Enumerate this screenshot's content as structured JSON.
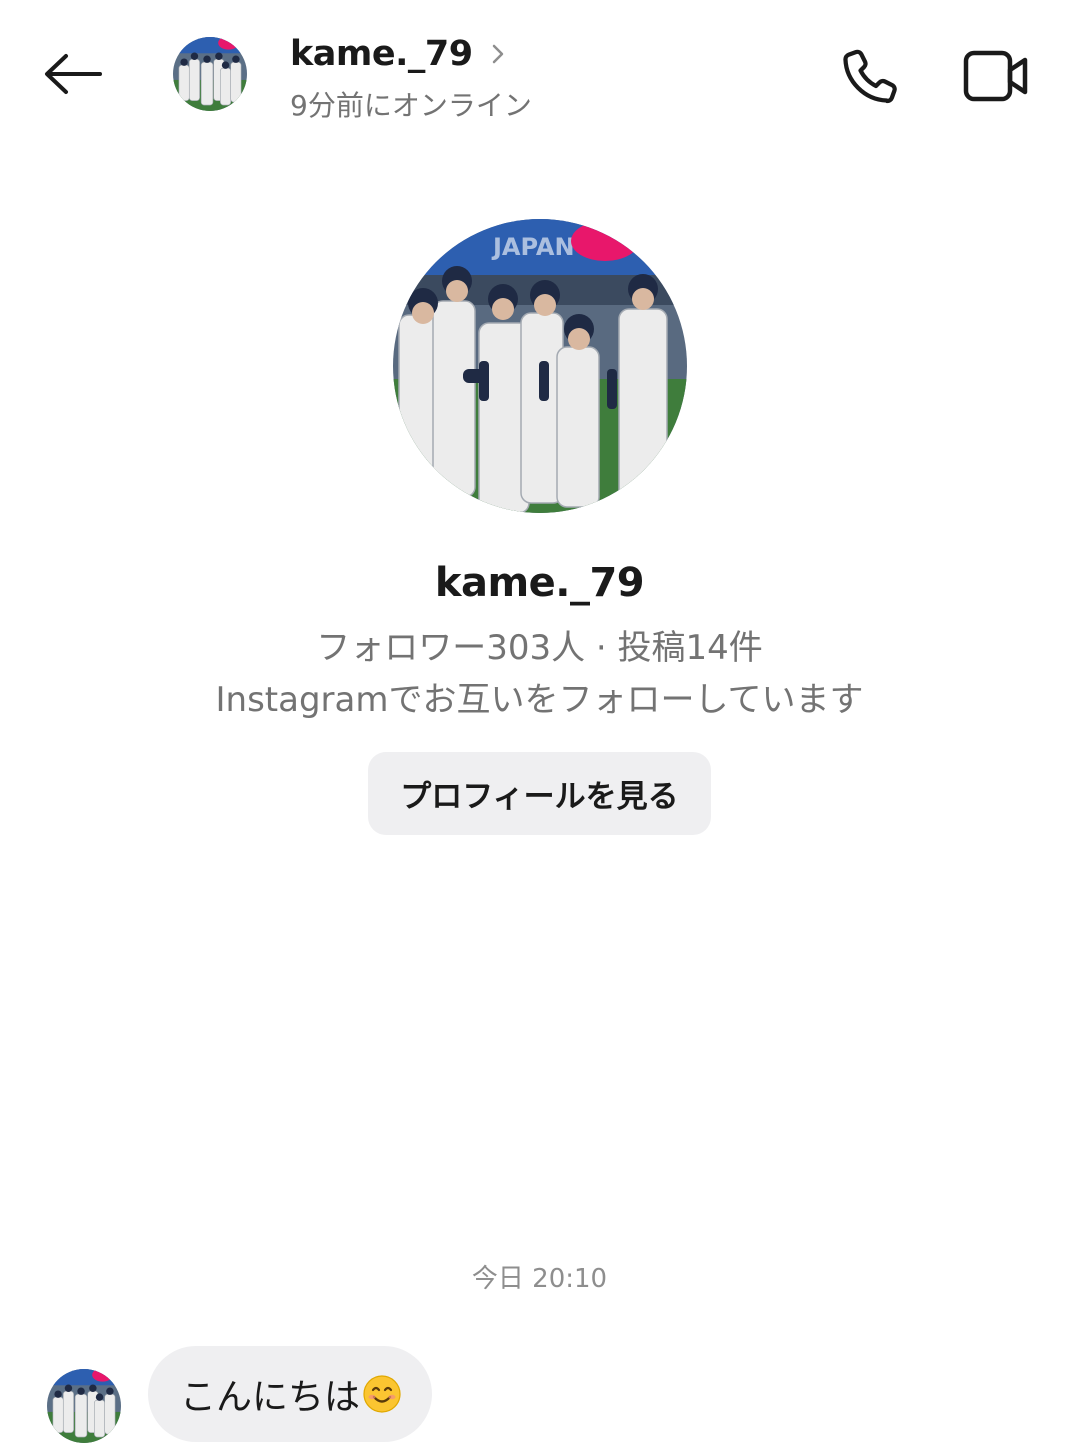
{
  "header": {
    "username": "kame._79",
    "status": "9分前にオンライン"
  },
  "profile": {
    "name": "kame._79",
    "stats": "フォロワー303人 · 投稿14件",
    "mutual": "Instagramでお互いをフォローしています",
    "view_profile_label": "プロフィールを見る",
    "photo_banner_text": "JAPAN"
  },
  "thread": {
    "timestamp": "今日 20:10",
    "messages": [
      {
        "sender": "kame._79",
        "text": "こんにちは",
        "emoji": "smiling-face-icon"
      }
    ]
  },
  "icons": {
    "back": "arrow-left-icon",
    "call": "phone-icon",
    "video": "video-camera-icon",
    "chevron": "chevron-right-icon"
  },
  "colors": {
    "text_primary": "#1a1a1a",
    "text_secondary": "#737373",
    "bubble_bg": "#efeff1",
    "banner_blue": "#2d5fb0",
    "banner_pink": "#e8176b",
    "field_green": "#3f7d3c"
  }
}
